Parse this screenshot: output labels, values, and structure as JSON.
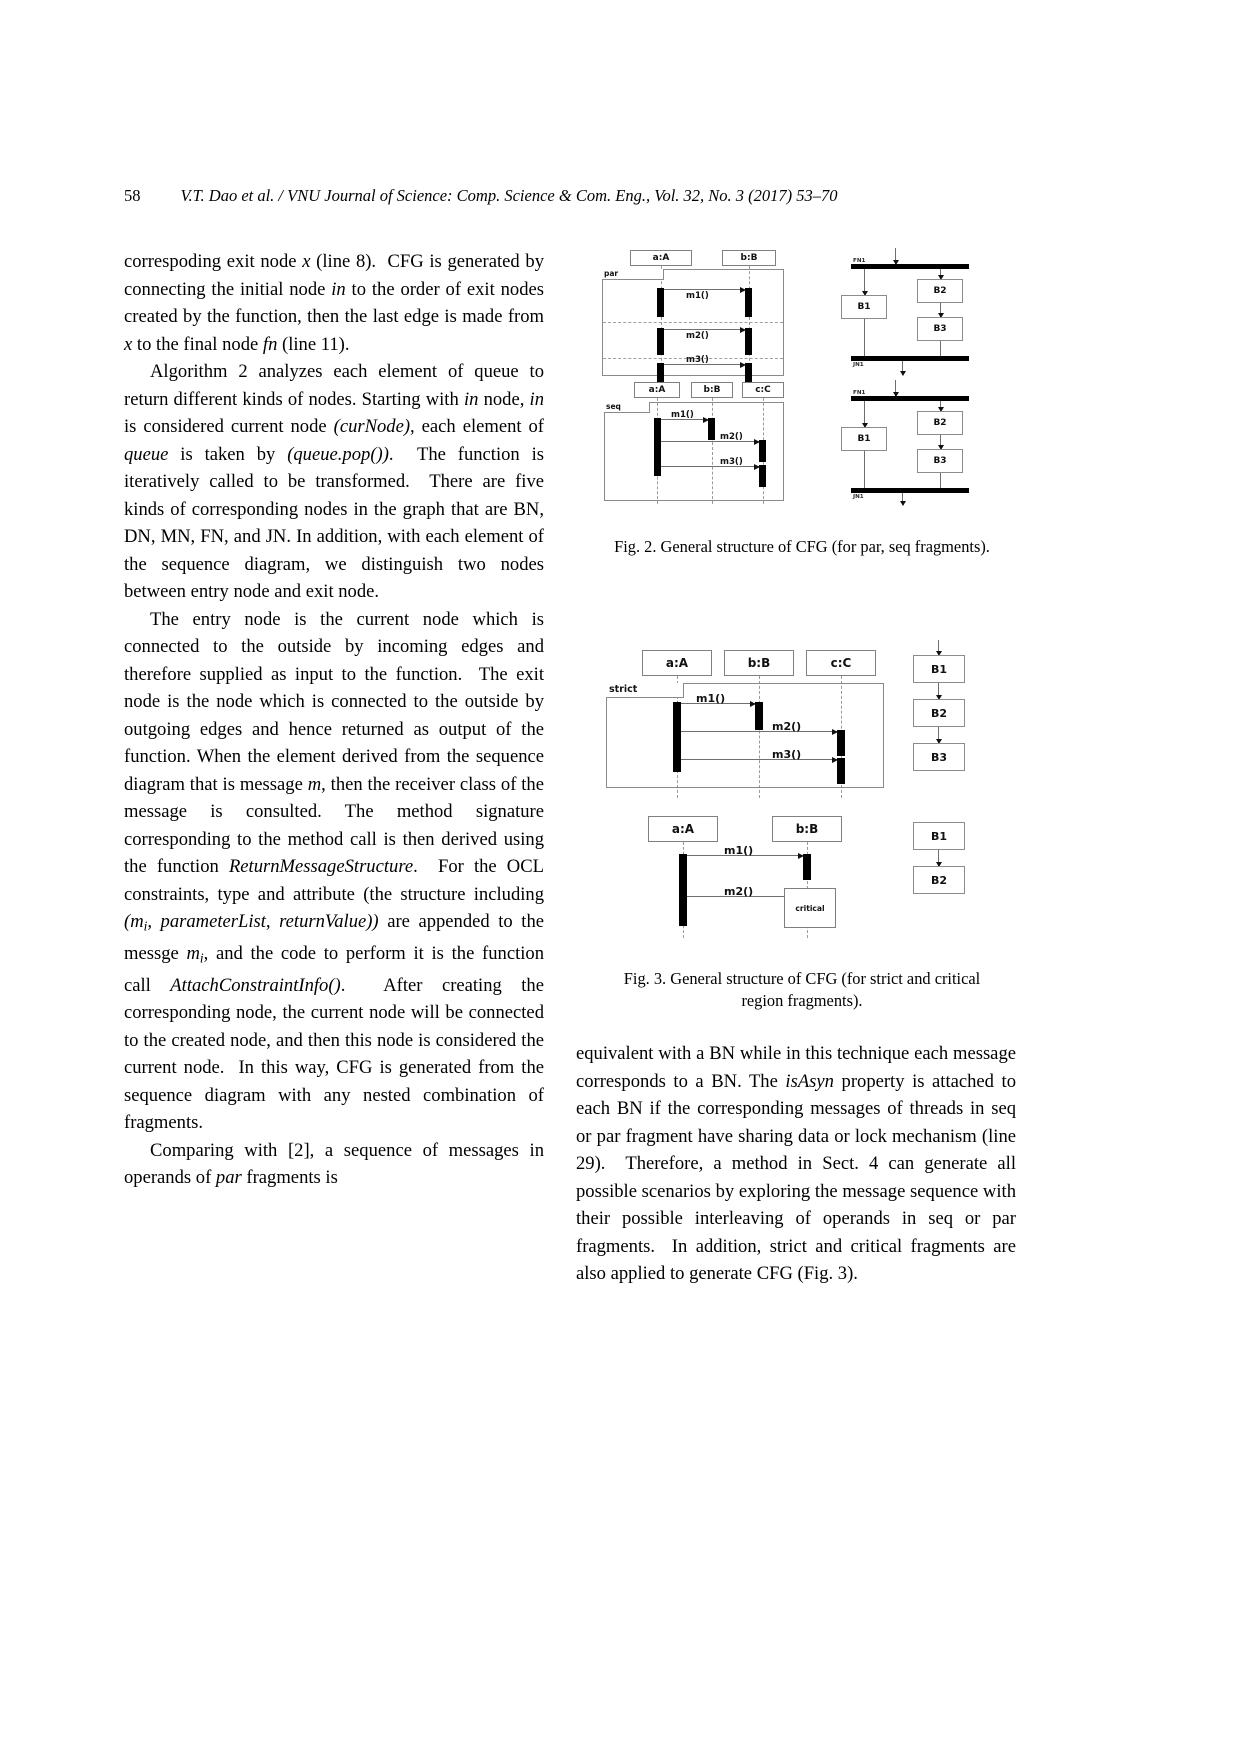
{
  "page": {
    "number": "58",
    "running_head": "V.T. Dao et al. / VNU Journal of Science: Comp. Science & Com. Eng., Vol. 32, No. 3 (2017) 53–70"
  },
  "left_column": {
    "paragraphs": [
      "correspoding exit node x (line 8).  CFG is generated by connecting the initial node in to the order of exit nodes created by the function, then the last edge is made from x to the final node fn (line 11).",
      "Algorithm 2 analyzes each element of queue to return different kinds of nodes. Starting with in node, in is considered current node (curNode), each element of queue is taken by (queue.pop()).  The function is iteratively called to be transformed.  There are five kinds of corresponding nodes in the graph that are BN, DN, MN, FN, and JN. In addition, with each element of the sequence diagram, we distinguish two nodes between entry node and exit node.",
      "The entry node is the current node which is connected to the outside by incoming edges and therefore supplied as input to the function.  The exit node is the node which is connected to the outside by outgoing edges and hence returned as output of the function. When the element derived from the sequence diagram that is message m, then the receiver class of the message is consulted. The method signature corresponding to the method call is then derived using the function ReturnMessageStructure.  For the OCL constraints, type and attribute (the structure including (mi, parameterList, returnValue)) are appended to the messge mi, and the code to perform it is the function call AttachConstraintInfo().  After creating the corresponding node, the current node will be connected to the created node, and then this node is considered the current node.  In this way, CFG is generated from the sequence diagram with any nested combination of fragments.",
      "Comparing with [2], a sequence of messages in operands of par fragments is"
    ]
  },
  "right_column": {
    "paragraph": "equivalent with a BN while in this technique each message corresponds to a BN. The isAsyn property is attached to each BN if the corresponding messages of threads in seq or par fragment have sharing data or lock mechanism (line 29).  Therefore, a method in Sect. 4 can generate all possible scenarios by exploring the message sequence with their possible interleaving of operands in seq or par fragments.  In addition, strict and critical fragments are also applied to generate CFG (Fig. 3)."
  },
  "figures": [
    {
      "id": "fig2",
      "caption": "Fig. 2. General structure of CFG (for par, seq fragments).",
      "diagrams": [
        {
          "kind": "sequence",
          "fragment": "par",
          "lifelines": [
            "a:A",
            "b:B"
          ],
          "messages": [
            "m1()",
            "m2()",
            "m3()"
          ]
        },
        {
          "kind": "sequence",
          "fragment": "seq",
          "lifelines": [
            "a:A",
            "b:B",
            "c:C"
          ],
          "messages": [
            "m1()",
            "m2()",
            "m3()"
          ]
        },
        {
          "kind": "cfg",
          "fork_label": "FN1",
          "join_label": "JN1",
          "nodes": [
            "B1",
            "B2",
            "B3"
          ]
        },
        {
          "kind": "cfg",
          "fork_label": "FN1",
          "join_label": "JN1",
          "nodes": [
            "B1",
            "B2",
            "B3"
          ]
        }
      ]
    },
    {
      "id": "fig3",
      "caption": "Fig. 3. General structure of CFG (for strict and critical region fragments).",
      "diagrams": [
        {
          "kind": "sequence",
          "fragment": "strict",
          "lifelines": [
            "a:A",
            "b:B",
            "c:C"
          ],
          "messages": [
            "m1()",
            "m2()",
            "m3()"
          ]
        },
        {
          "kind": "cfg",
          "nodes": [
            "B1",
            "B2",
            "B3"
          ]
        },
        {
          "kind": "sequence",
          "fragment": "critical",
          "lifelines": [
            "a:A",
            "b:B"
          ],
          "messages": [
            "m1()",
            "m2()"
          ],
          "region_label": "critical"
        },
        {
          "kind": "cfg",
          "nodes": [
            "B1",
            "B2"
          ]
        }
      ]
    }
  ]
}
